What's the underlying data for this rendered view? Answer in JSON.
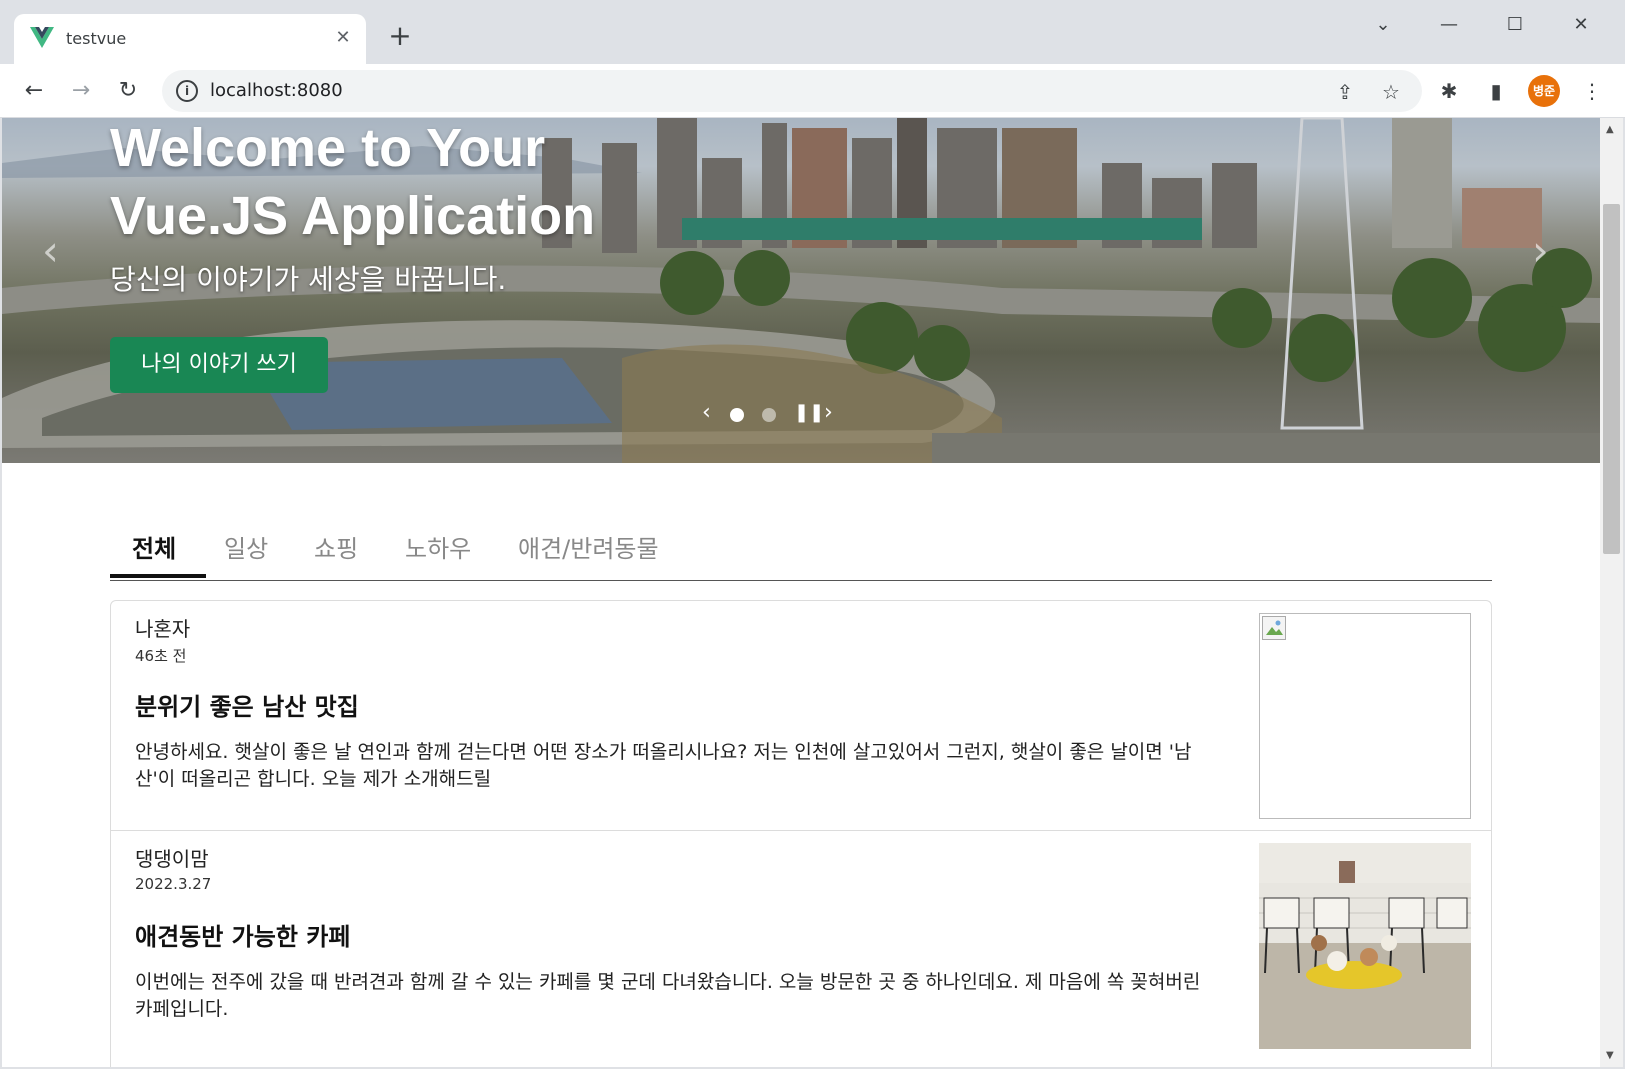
{
  "browser": {
    "tab_title": "testvue",
    "url": "localhost:8080",
    "profile_initials": "병준"
  },
  "hero": {
    "title": "Welcome to Your\nVue.JS Application",
    "subtitle": "당신의 이야기가 세상을 바꿉니다.",
    "cta_label": "나의 이야기 쓰기"
  },
  "categories": {
    "items": [
      "전체",
      "일상",
      "쇼핑",
      "노하우",
      "애견/반려동물"
    ],
    "active": "전체"
  },
  "posts": [
    {
      "author": "나혼자",
      "date": "46초 전",
      "title": "분위기 좋은 남산 맛집",
      "body": "안녕하세요. 햇살이 좋은 날 연인과 함께 걷는다면 어떤 장소가 떠올리시나요? 저는 인천에 살고있어서 그런지, 햇살이 좋은 날이면 '남산'이 떠올리곤 합니다. 오늘 제가 소개해드릴"
    },
    {
      "author": "댕댕이맘",
      "date": "2022.3.27",
      "title": "애견동반 가능한 카페",
      "body": "이번에는 전주에 갔을 때 반려견과 함께 갈 수 있는 카페를 몇 군데 다녀왔습니다. 오늘 방문한 곳 중 하나인데요. 제 마음에 쏙 꽂혀버린 카페입니다."
    }
  ],
  "colors": {
    "cta": "#198754",
    "profile": "#e8710a"
  }
}
